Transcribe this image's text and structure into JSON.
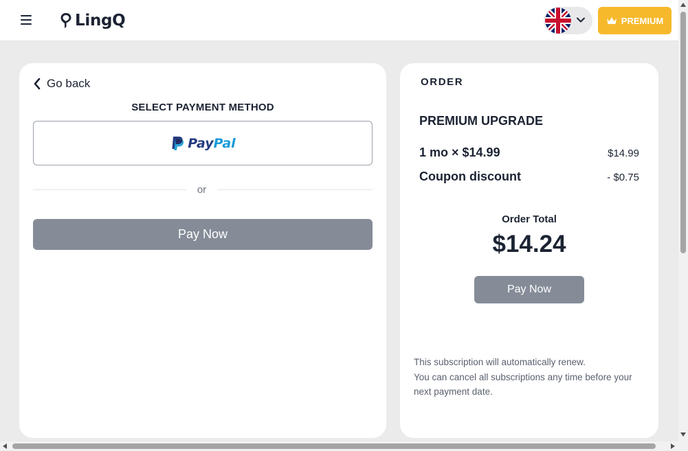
{
  "header": {
    "menu_icon": "hamburger-menu-icon",
    "logo_text": "LingQ",
    "language_flag": "uk-flag-icon",
    "premium_label": "PREMIUM",
    "premium_color": "#f7b92c"
  },
  "payment": {
    "go_back_label": "Go back",
    "section_title": "SELECT PAYMENT METHOD",
    "paypal_pay": "Pay",
    "paypal_pal": "Pal",
    "divider_text": "or",
    "pay_now_label": "Pay Now",
    "button_color": "#858c98"
  },
  "order": {
    "label": "ORDER",
    "plan_title": "PREMIUM UPGRADE",
    "line_items": [
      {
        "label": "1 mo × $14.99",
        "amount": "$14.99"
      },
      {
        "label": "Coupon discount",
        "amount": "- $0.75"
      }
    ],
    "total_label": "Order Total",
    "total_amount": "$14.24",
    "pay_now_label": "Pay Now",
    "renewal_note": [
      "This subscription will automatically renew.",
      "You can cancel all subscriptions any time before your next payment date."
    ]
  }
}
